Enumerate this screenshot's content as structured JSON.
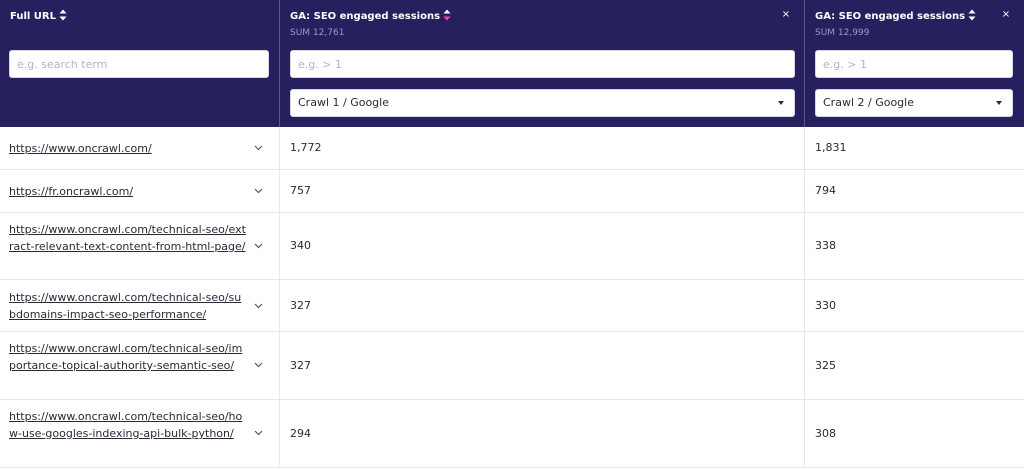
{
  "columns": [
    {
      "title": "Full URL",
      "sort": "none"
    },
    {
      "title": "GA: SEO engaged sessions",
      "sum": "SUM 12,761",
      "filter_placeholder": "e.g. > 1",
      "source": "Crawl 1 / Google",
      "sort": "desc"
    },
    {
      "title": "GA: SEO engaged sessions",
      "sum": "SUM 12,999",
      "filter_placeholder": "e.g. > 1",
      "source": "Crawl 2 / Google",
      "sort": "none"
    }
  ],
  "url_filter_placeholder": "e.g. search term",
  "close_glyph": "×",
  "colors": {
    "header_bg": "#27205f",
    "sort_active": "#ef4f8b",
    "sum_text": "#9d97c9"
  },
  "rows": [
    {
      "url": "https://www.oncrawl.com/",
      "crawl1": "1,772",
      "crawl2": "1,831"
    },
    {
      "url": "https://fr.oncrawl.com/",
      "crawl1": "757",
      "crawl2": "794"
    },
    {
      "url": "https://www.oncrawl.com/technical-seo/extract-relevant-text-content-from-html-page/",
      "crawl1": "340",
      "crawl2": "338"
    },
    {
      "url": "https://www.oncrawl.com/technical-seo/subdomains-impact-seo-performance/",
      "crawl1": "327",
      "crawl2": "330"
    },
    {
      "url": "https://www.oncrawl.com/technical-seo/importance-topical-authority-semantic-seo/",
      "crawl1": "327",
      "crawl2": "325"
    },
    {
      "url": "https://www.oncrawl.com/technical-seo/how-use-googles-indexing-api-bulk-python/",
      "crawl1": "294",
      "crawl2": "308"
    }
  ]
}
